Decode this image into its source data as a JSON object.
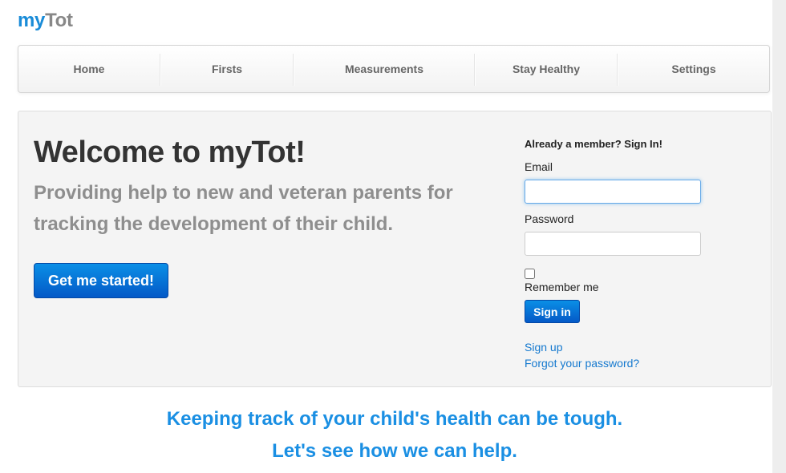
{
  "brand": {
    "part1": "my",
    "part2": "Tot"
  },
  "nav": {
    "items": [
      {
        "label": "Home"
      },
      {
        "label": "Firsts"
      },
      {
        "label": "Measurements"
      },
      {
        "label": "Stay Healthy"
      },
      {
        "label": "Settings"
      }
    ]
  },
  "hero": {
    "title": "Welcome to myTot!",
    "lead": "Providing help to new and veteran parents for tracking the development of their child.",
    "cta_label": "Get me started!"
  },
  "signin": {
    "heading": "Already a member? Sign In!",
    "email_label": "Email",
    "email_value": "",
    "password_label": "Password",
    "password_value": "",
    "remember_label": "Remember me",
    "remember_checked": false,
    "button_label": "Sign in",
    "signup_link": "Sign up",
    "forgot_link": "Forgot your password?"
  },
  "tagline": {
    "line1": "Keeping track of your child's health can be tough.",
    "line2": "Let's see how we can help."
  },
  "colors": {
    "brand_blue": "#1a8cd8",
    "button_blue": "#0459c7",
    "link_blue": "#1579cf",
    "tagline_blue": "#1a8fe3"
  }
}
